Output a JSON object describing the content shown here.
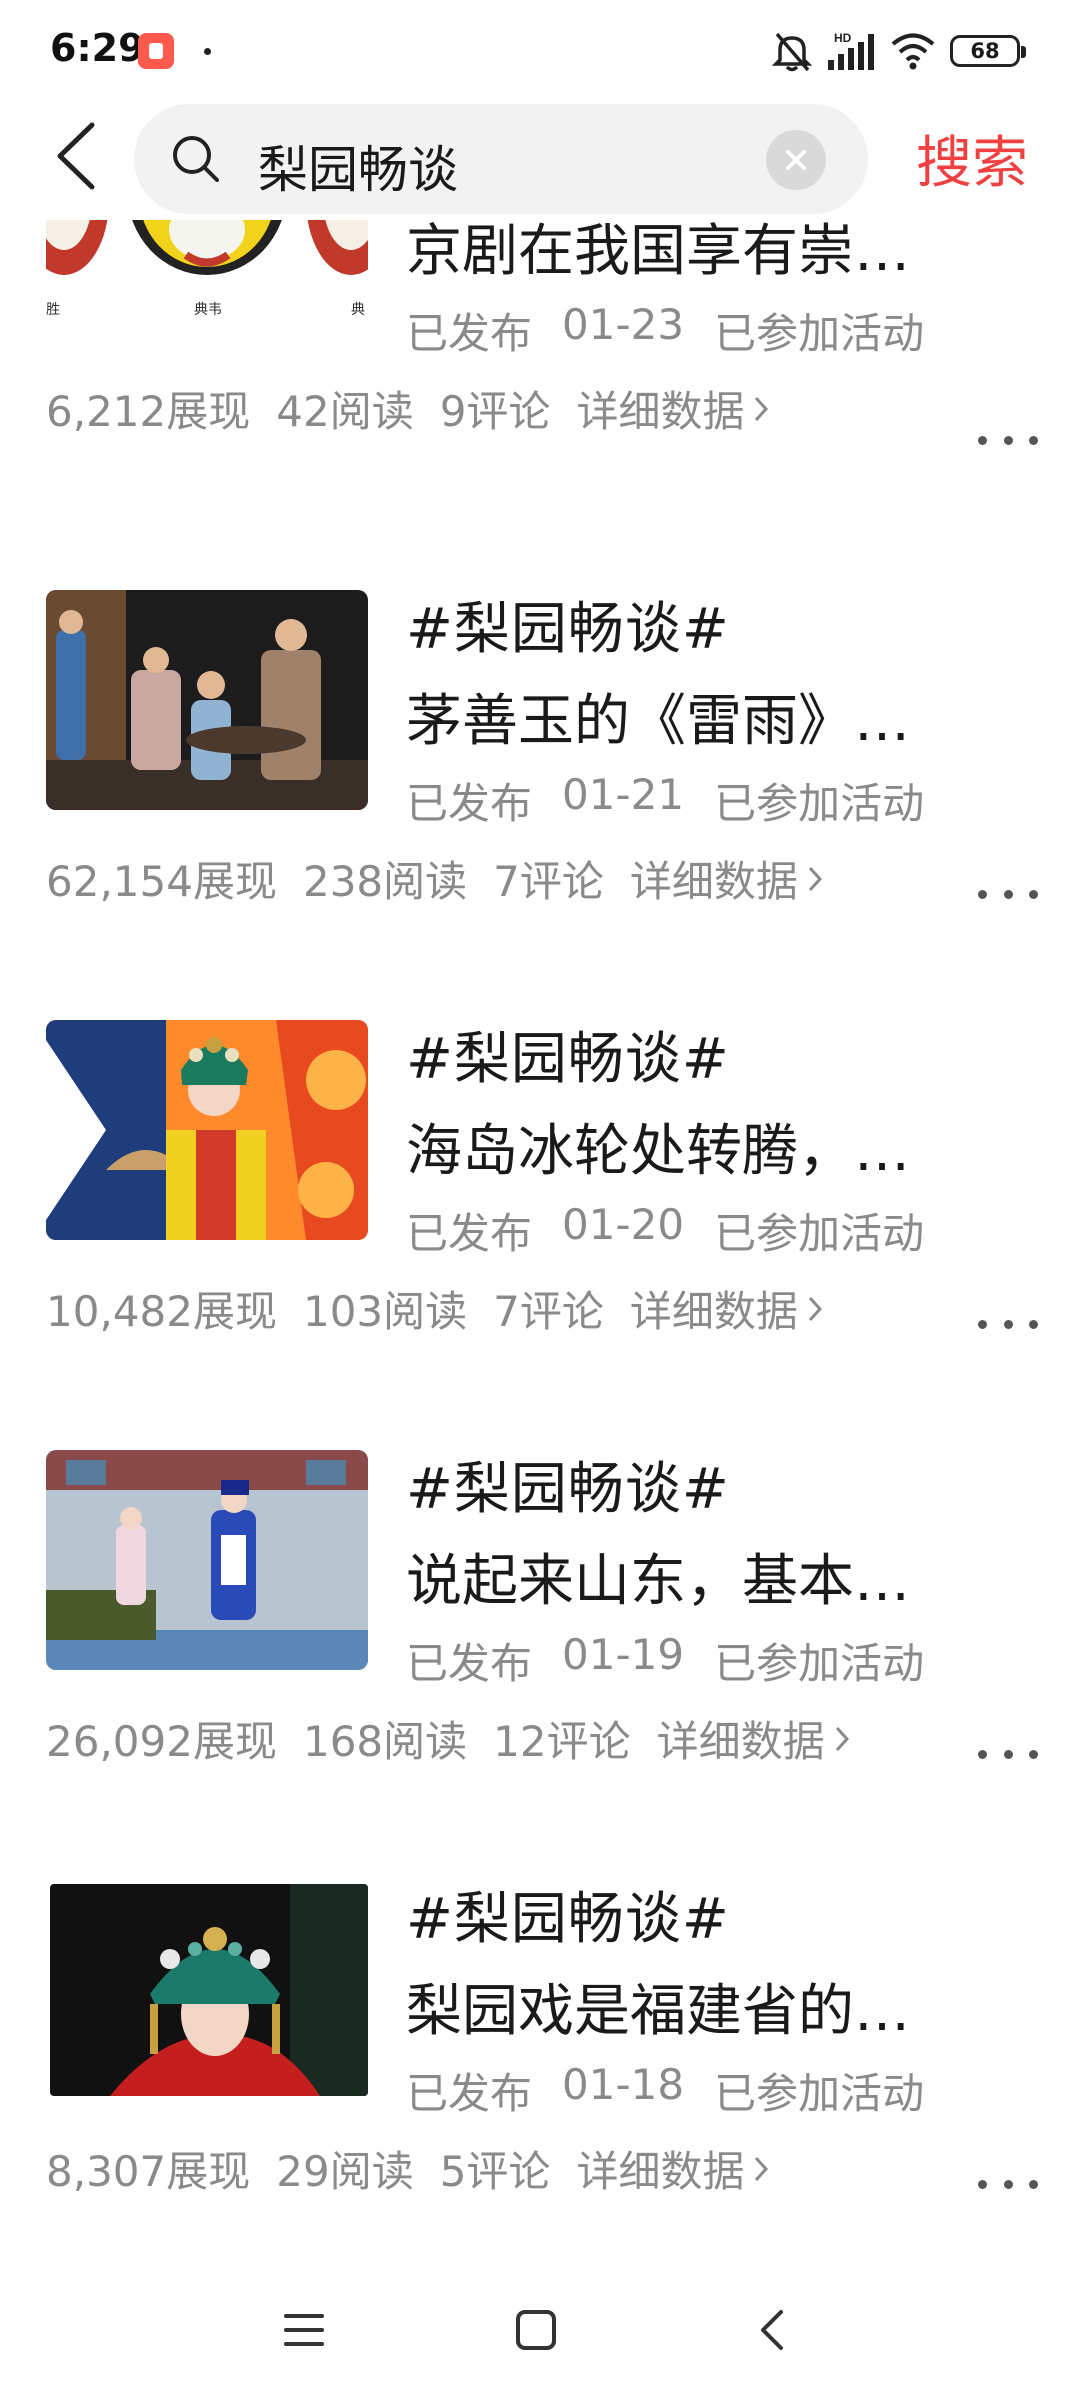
{
  "status_bar": {
    "time": "6:29",
    "battery": "68",
    "network_label": "HD"
  },
  "search": {
    "query": "梨园畅谈",
    "submit_label": "搜索"
  },
  "articles": [
    {
      "title_line1": "",
      "title_line2": "京剧在我国享有崇…",
      "status": "已发布",
      "date": "01-23",
      "activity": "已参加活动",
      "views": "6,212展现",
      "reads": "42阅读",
      "comments": "9评论",
      "detail_label": "详细数据",
      "thumb_labels": [
        "胜",
        "典韦",
        "典"
      ]
    },
    {
      "title_line1": "#梨园畅谈#",
      "title_line2": "茅善玉的《雷雨》…",
      "status": "已发布",
      "date": "01-21",
      "activity": "已参加活动",
      "views": "62,154展现",
      "reads": "238阅读",
      "comments": "7评论",
      "detail_label": "详细数据"
    },
    {
      "title_line1": "#梨园畅谈#",
      "title_line2": "海岛冰轮处转腾，…",
      "status": "已发布",
      "date": "01-20",
      "activity": "已参加活动",
      "views": "10,482展现",
      "reads": "103阅读",
      "comments": "7评论",
      "detail_label": "详细数据"
    },
    {
      "title_line1": "#梨园畅谈#",
      "title_line2": "说起来山东，基本…",
      "status": "已发布",
      "date": "01-19",
      "activity": "已参加活动",
      "views": "26,092展现",
      "reads": "168阅读",
      "comments": "12评论",
      "detail_label": "详细数据"
    },
    {
      "title_line1": "#梨园畅谈#",
      "title_line2": "梨园戏是福建省的…",
      "status": "已发布",
      "date": "01-18",
      "activity": "已参加活动",
      "views": "8,307展现",
      "reads": "29阅读",
      "comments": "5评论",
      "detail_label": "详细数据"
    }
  ],
  "colors": {
    "accent": "#f04142",
    "meta_text": "#8a8a8a",
    "title_text": "#1a1a1a"
  }
}
